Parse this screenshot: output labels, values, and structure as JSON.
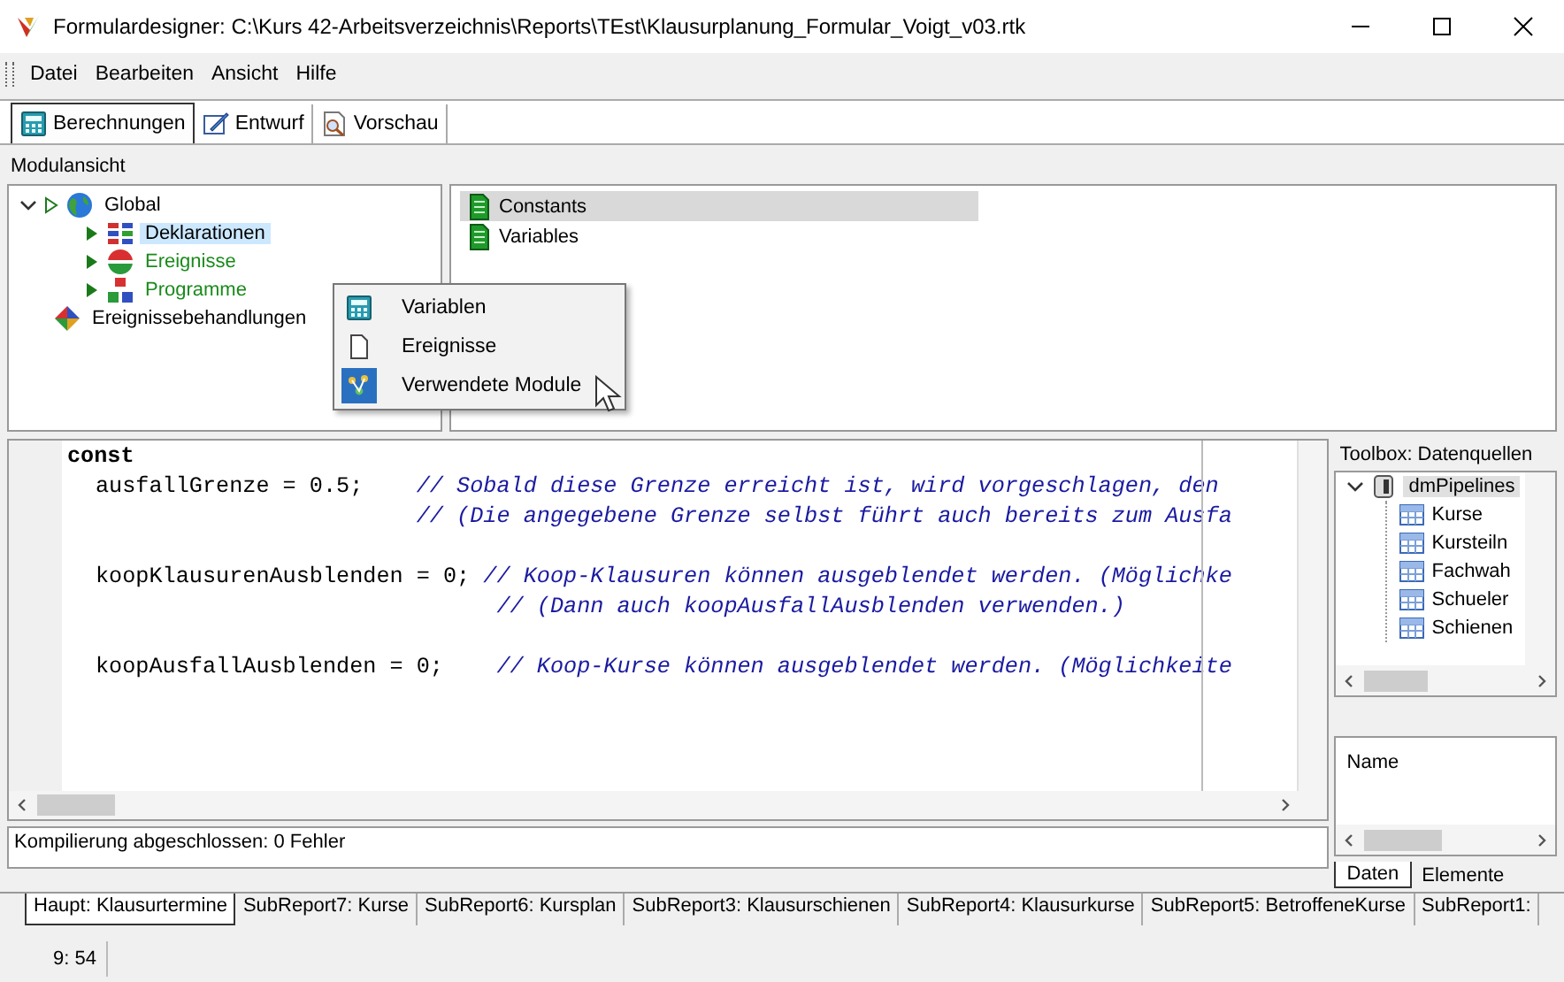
{
  "window": {
    "title": "Formulardesigner: C:\\Kurs 42-Arbeitsverzeichnis\\Reports\\TEst\\Klausurplanung_Formular_Voigt_v03.rtk"
  },
  "menu": [
    "Datei",
    "Bearbeiten",
    "Ansicht",
    "Hilfe"
  ],
  "tabs": [
    {
      "label": "Berechnungen",
      "selected": true,
      "kind": "calc"
    },
    {
      "label": "Entwurf",
      "selected": false,
      "kind": "design"
    },
    {
      "label": "Vorschau",
      "selected": false,
      "kind": "preview"
    }
  ],
  "module_view": {
    "label": "Modulansicht",
    "tree": [
      {
        "label": "Global",
        "kind": "globe",
        "expanded": true,
        "selected": false,
        "color": "#000000",
        "children": [
          {
            "label": "Deklarationen",
            "kind": "decl",
            "selected": true,
            "color": "#000000"
          },
          {
            "label": "Ereignisse",
            "kind": "events",
            "selected": false,
            "color": "#1a8a1a"
          },
          {
            "label": "Programme",
            "kind": "programs",
            "selected": false,
            "color": "#1a8a1a"
          }
        ]
      },
      {
        "label": "Ereignissebehandlungen",
        "kind": "handlers",
        "selected": false,
        "color": "#000000"
      }
    ],
    "list": [
      {
        "label": "Constants",
        "selected": true
      },
      {
        "label": "Variables",
        "selected": false
      }
    ]
  },
  "context_menu": {
    "items": [
      {
        "label": "Variablen",
        "kind": "calc",
        "selected": false
      },
      {
        "label": "Ereignisse",
        "kind": "page",
        "selected": false
      },
      {
        "label": "Verwendete Module",
        "kind": "modules",
        "selected": true
      }
    ]
  },
  "editor": {
    "blocks": [
      {
        "lines": [
          {
            "kind": "keyword",
            "code": "const"
          },
          {
            "kind": "code",
            "code": "ausfallGrenze = 0.5;",
            "comment": "// Sobald diese Grenze erreicht ist, wird vorgeschlagen, den"
          },
          {
            "kind": "continuation",
            "comment": "// (Die angegebene Grenze selbst führt auch bereits zum Ausfa"
          }
        ]
      },
      {
        "lines": [
          {
            "kind": "code",
            "code": "koopKlausurenAusblenden = 0;",
            "comment": "// Koop-Klausuren können ausgeblendet werden. (Möglichke"
          },
          {
            "kind": "continuation",
            "comment": "// (Dann auch koopAusfallAusblenden verwenden.)"
          }
        ]
      },
      {
        "lines": [
          {
            "kind": "code",
            "code": "koopAusfallAusblenden = 0;",
            "comment": "// Koop-Kurse können ausgeblendet werden. (Möglichkeite"
          }
        ]
      }
    ]
  },
  "message": "Kompilierung abgeschlossen: 0 Fehler",
  "toolbox": {
    "title": "Toolbox: Datenquellen",
    "tree": [
      {
        "label": "dmPipelines",
        "expanded": true,
        "selected": true,
        "children": [
          {
            "label": "Kurse"
          },
          {
            "label": "Kursteiln"
          },
          {
            "label": "Fachwah"
          },
          {
            "label": "Schueler"
          },
          {
            "label": "Schienen"
          }
        ]
      }
    ],
    "properties": {
      "label": "Name"
    },
    "tabs": [
      {
        "label": "Daten",
        "selected": true
      },
      {
        "label": "Elemente",
        "selected": false
      }
    ]
  },
  "report_tabs": [
    {
      "label": "Haupt: Klausurtermine",
      "selected": true
    },
    {
      "label": "SubReport7: Kurse",
      "selected": false
    },
    {
      "label": "SubReport6: Kursplan",
      "selected": false
    },
    {
      "label": "SubReport3: Klausurschienen",
      "selected": false
    },
    {
      "label": "SubReport4: Klausurkurse",
      "selected": false
    },
    {
      "label": "SubReport5: BetroffeneKurse",
      "selected": false
    },
    {
      "label": "SubReport1:",
      "selected": false
    }
  ],
  "status_bar": {
    "position": "9: 54"
  }
}
